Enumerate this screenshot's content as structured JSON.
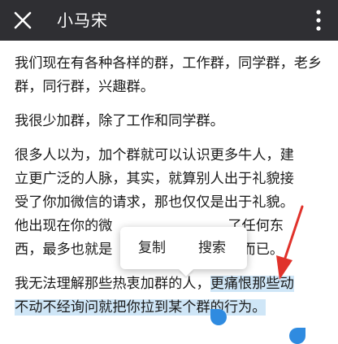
{
  "toolbar": {
    "title": "小马宋",
    "close_icon": "close-icon",
    "more_icon": "more-vert-icon"
  },
  "article": {
    "paragraphs": [
      "我们现在有各种各样的群，工作群，同学群，老乡群，同行群，兴趣群。",
      "我很少加群，除了工作和同学群。",
      {
        "line1": "很多人以为，加个群就可以认识更多牛人，建",
        "line2": "立更广泛的人脉，其实，就算别人出于礼貌接",
        "line3": "受了你加微信的请求，那也仅仅是出于礼貌。",
        "line4_start": "他出现在你的微",
        "line4_end": "了任何东",
        "line5_start": "西，最多也就是",
        "line5_end": "井而已。"
      },
      {
        "unselected": "我无法理解那些热衷加群的人，",
        "selected_line1": "更痛恨那些动",
        "selected_line2": "不动不经询问就把你拉到某个群的行为。"
      }
    ]
  },
  "selection_menu": {
    "copy_label": "复制",
    "search_label": "搜索"
  },
  "colors": {
    "toolbar_bg": "#2f2f33",
    "selection_bg": "#cfe6f7",
    "handle": "#2f8be0",
    "annotation_arrow": "#e0322b"
  }
}
